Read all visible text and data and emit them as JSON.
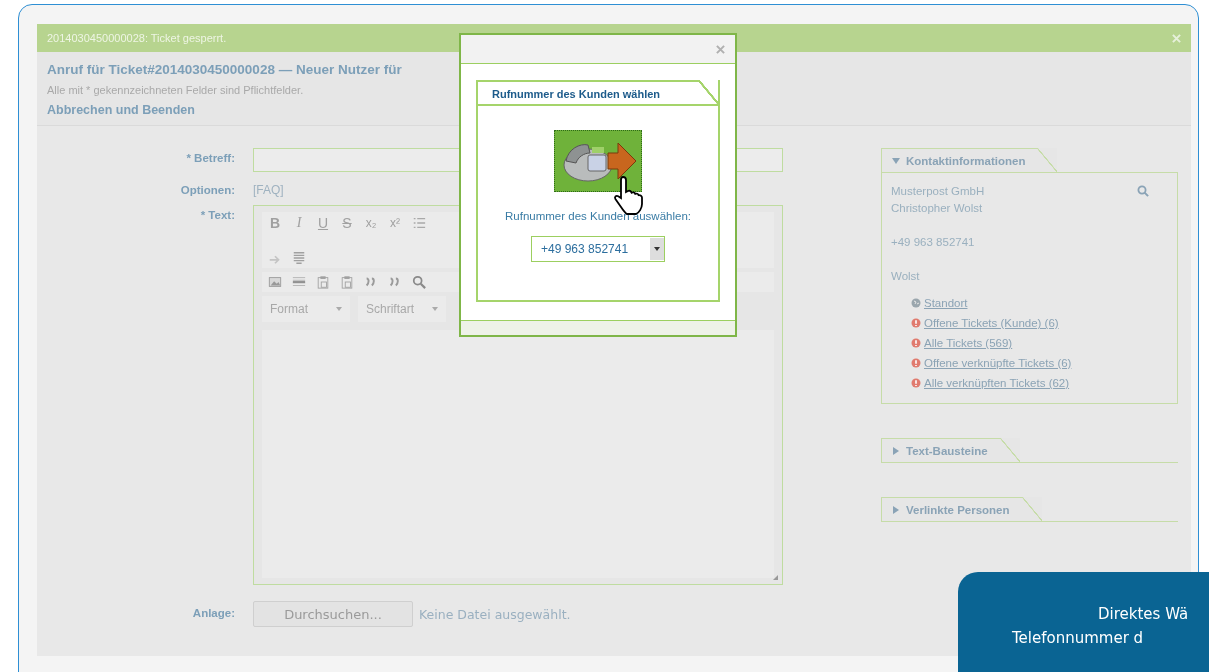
{
  "notice": {
    "text": "2014030450000028: Ticket gesperrt."
  },
  "header": {
    "title": "Anruf für Ticket#2014030450000028 — Neuer Nutzer für",
    "hint": "Alle mit * gekennzeichneten Felder sind Pflichtfelder.",
    "cancel_link": "Abbrechen und Beenden"
  },
  "form": {
    "subject_label": "* Betreff:",
    "options_label": "Optionen:",
    "options_link": "[FAQ]",
    "text_label": "* Text:",
    "toolbar_row1": [
      {
        "kind": "bold",
        "label": "B"
      },
      {
        "kind": "italic",
        "label": "I"
      },
      {
        "kind": "underline",
        "label": "U"
      },
      {
        "kind": "strike",
        "label": "S"
      },
      {
        "kind": "plain",
        "label": "x₂"
      },
      {
        "kind": "plain",
        "label": "x²"
      },
      {
        "kind": "numbered-list"
      }
    ],
    "toolbar_row1b": [
      {
        "kind": "redo"
      },
      {
        "kind": "template"
      }
    ],
    "toolbar_row2": [
      {
        "kind": "image"
      },
      {
        "kind": "rule"
      },
      {
        "kind": "paste"
      },
      {
        "kind": "paste"
      },
      {
        "kind": "quote"
      },
      {
        "kind": "quote"
      },
      {
        "kind": "search"
      }
    ],
    "dropdowns": [
      "Format",
      "Schriftart"
    ],
    "attachment_label": "Anlage:",
    "browse_button": "Durchsuchen...",
    "no_file": "Keine Datei ausgewählt."
  },
  "sidebar": [
    {
      "title": "Kontaktinformationen",
      "expanded": true,
      "lines": [
        "Musterpost GmbH",
        "Christopher Wolst",
        "+49 963 852741",
        "Wolst"
      ],
      "links": [
        {
          "kind": "globe",
          "label": "Standort"
        },
        {
          "kind": "alert",
          "label": "Offene Tickets (Kunde) (6)"
        },
        {
          "kind": "alert",
          "label": "Alle Tickets (569)"
        },
        {
          "kind": "alert",
          "label": "Offene verknüpfte Tickets (6)"
        },
        {
          "kind": "alert",
          "label": "Alle verknüpften Tickets (62)"
        }
      ]
    },
    {
      "title": "Text-Bausteine",
      "expanded": false
    },
    {
      "title": "Verlinkte Personen",
      "expanded": false
    }
  ],
  "dialog": {
    "tab_title": "Rufnummer des Kunden wählen",
    "label": "Rufnummer des Kunden auswählen:",
    "selected_number": "+49 963 852741"
  },
  "callout": {
    "lines": [
      "Direktes Wä",
      "Telefonnummer d"
    ]
  }
}
